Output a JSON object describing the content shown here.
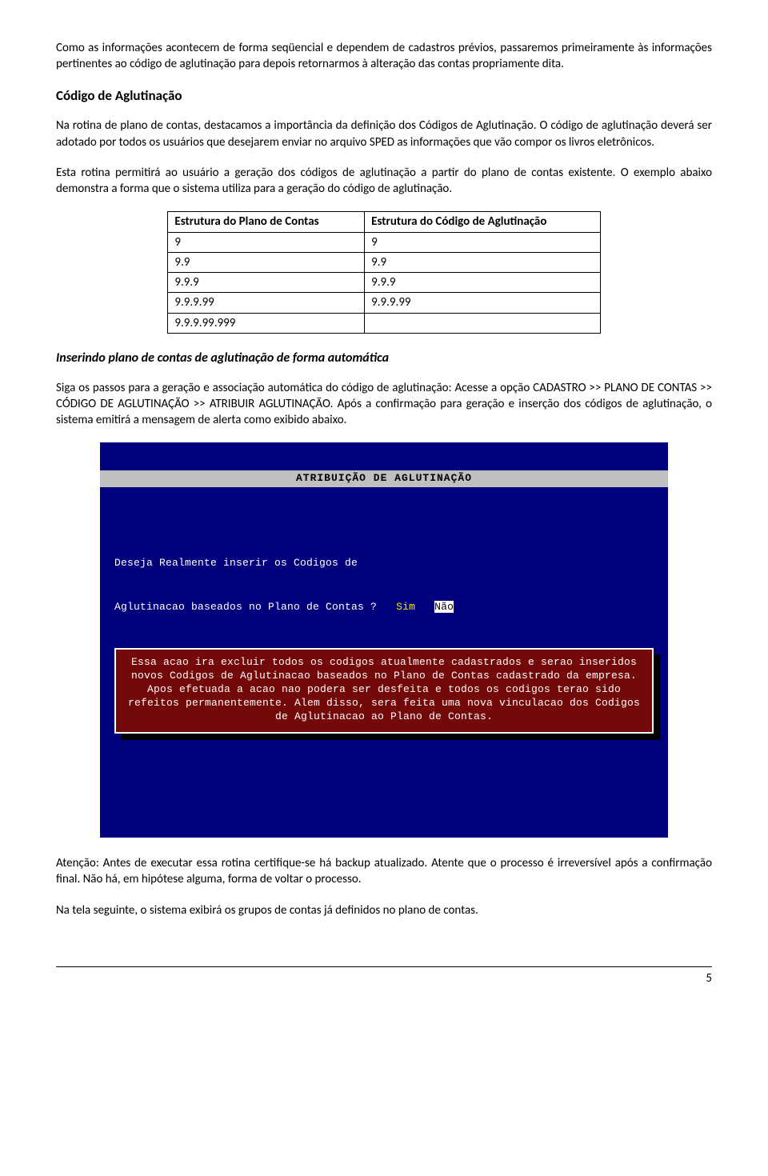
{
  "p1": "Como as informações acontecem de forma seqüencial e dependem de cadastros prévios, passaremos primeiramente às informações pertinentes ao código de aglutinação para depois retornarmos à alteração das contas propriamente dita.",
  "h2_codigo": "Código de Aglutinação",
  "p2": "Na rotina de plano de contas, destacamos a importância da definição dos Códigos de Aglutinação. O código de aglutinação deverá ser adotado por todos os usuários que desejarem enviar no arquivo SPED as informações que vão compor os livros eletrônicos.",
  "p3": "Esta rotina permitirá ao usuário a geração dos códigos de aglutinação a partir do plano de contas existente. O exemplo abaixo demonstra a forma que o sistema utiliza para a geração do código de aglutinação.",
  "table": {
    "head": {
      "c1": "Estrutura do Plano de Contas",
      "c2": "Estrutura do Código de Aglutinação"
    },
    "rows": [
      {
        "c1": "9",
        "c2": "9"
      },
      {
        "c1": "9.9",
        "c2": "9.9"
      },
      {
        "c1": "9.9.9",
        "c2": "9.9.9"
      },
      {
        "c1": "9.9.9.99",
        "c2": "9.9.9.99"
      },
      {
        "c1": "9.9.9.99.999",
        "c2": ""
      }
    ]
  },
  "h3_inserindo": "Inserindo plano de contas de aglutinação de forma automática",
  "p4": "Siga os passos para a geração e associação automática do código de aglutinação: Acesse a opção CADASTRO >> PLANO DE CONTAS >> CÓDIGO DE AGLUTINAÇÃO >> ATRIBUIR AGLUTINAÇÃO. Após a confirmação para geração e inserção dos códigos de aglutinação, o sistema emitirá a mensagem de alerta como exibido abaixo.",
  "terminal": {
    "title": "ATRIBUIÇÃO DE AGLUTINAÇÃO",
    "line1": "Deseja Realmente inserir os Codigos de",
    "line2_pre": "Aglutinacao baseados no Plano de Contas ?   ",
    "opt_yes": "Sim",
    "opt_sep": "   ",
    "opt_no": "Não",
    "alert": "Essa acao ira excluir todos os codigos atualmente cadastrados e serao inseridos novos Codigos de Aglutinacao baseados no Plano de Contas cadastrado da empresa. Apos efetuada a acao nao podera ser desfeita e todos os codigos terao sido refeitos permanentemente. Alem disso, sera feita uma nova vinculacao dos Codigos de Aglutinacao ao Plano de Contas."
  },
  "p5": "Atenção: Antes de executar essa rotina certifique-se há backup atualizado. Atente que o processo é irreversível após a confirmação final. Não há, em hipótese alguma, forma de voltar o processo.",
  "p6": "Na tela seguinte, o sistema exibirá os grupos de contas já definidos no plano de contas.",
  "page_number": "5"
}
